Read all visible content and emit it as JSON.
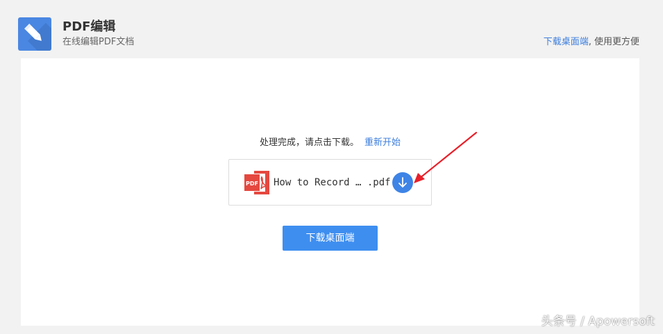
{
  "header": {
    "title": "PDF编辑",
    "subtitle": "在线编辑PDF文档",
    "promo_link": "下载桌面端",
    "promo_suffix": ", 使用更方便"
  },
  "main": {
    "status_text": "处理完成，请点击下载。",
    "restart_link": "重新开始",
    "file": {
      "name": "How to Record … .pdf",
      "icon": "pdf-file-icon"
    },
    "download_icon": "arrow-down-icon",
    "download_desktop_button": "下载桌面端"
  },
  "watermark": "头条号 / Apowersoft",
  "colors": {
    "accent": "#3e84e6",
    "link": "#3b7ddd",
    "pdf_red": "#e5483f",
    "annotation_arrow": "#e8202a"
  }
}
